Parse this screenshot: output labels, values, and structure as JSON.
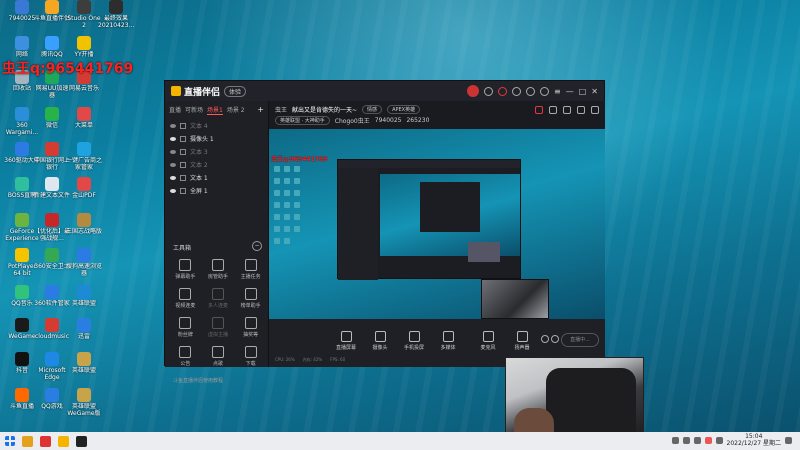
{
  "overlay": {
    "qq_text": "虫王q:965441769"
  },
  "desktop": {
    "icons": [
      {
        "label": "7940025",
        "color": "#3a78d6"
      },
      {
        "label": "斗鱼直播伴侣",
        "color": "#f5a623"
      },
      {
        "label": "Studio One 2",
        "color": "#3d3d3d"
      },
      {
        "label": "最终效果 20210423...",
        "color": "#2d2d2d"
      },
      {
        "label": "网络",
        "color": "#3d8fe0"
      },
      {
        "label": "腾讯QQ",
        "color": "#3aa0ff"
      },
      {
        "label": "YY开播",
        "color": "#f2c200"
      },
      {
        "label": "回收站",
        "color": "#a6b4bf"
      },
      {
        "label": "网易UU加速器",
        "color": "#1ea85b"
      },
      {
        "label": "网易云音乐",
        "color": "#d43c33"
      },
      {
        "label": "360 Wargami...",
        "color": "#2a8fd8"
      },
      {
        "label": "微信",
        "color": "#27b34a"
      },
      {
        "label": "大菜单",
        "color": "#e34848"
      },
      {
        "label": "360驱动大师",
        "color": "#2c7be5"
      },
      {
        "label": "中国银行网上银行",
        "color": "#d43c33"
      },
      {
        "label": "一键广告商之家管家",
        "color": "#1fa2e0"
      },
      {
        "label": "BOSS直聘",
        "color": "#2fbf9f"
      },
      {
        "label": "新建文本文件",
        "color": "#dfe6ee"
      },
      {
        "label": "金山PDF",
        "color": "#e34848"
      },
      {
        "label": "GeForce Experience",
        "color": "#6cb33f"
      },
      {
        "label": "【优化后】最强战舰...",
        "color": "#c62828"
      },
      {
        "label": "三国志战略版",
        "color": "#b38a3f"
      },
      {
        "label": "PotPlayer 64 bit",
        "color": "#f5c400"
      },
      {
        "label": "360安全卫士",
        "color": "#34a853"
      },
      {
        "label": "搜狗高速浏览器",
        "color": "#2c7be5"
      },
      {
        "label": "QQ音乐",
        "color": "#31c27c"
      },
      {
        "label": "360软件管家",
        "color": "#2c7be5"
      },
      {
        "label": "英雄联盟",
        "color": "#1e8ad6"
      },
      {
        "label": "WeGame",
        "color": "#1a1a1a"
      },
      {
        "label": "cloudmusic",
        "color": "#d43c33"
      },
      {
        "label": "迅雷",
        "color": "#2a7de1"
      },
      {
        "label": "抖音",
        "color": "#111111"
      },
      {
        "label": "Microsoft Edge",
        "color": "#1e88e5"
      },
      {
        "label": "英雄联盟",
        "color": "#c7a44a"
      },
      {
        "label": "斗鱼直播",
        "color": "#ff6a00"
      },
      {
        "label": "QQ游戏",
        "color": "#2a7de1"
      },
      {
        "label": "英雄联盟WeGame版",
        "color": "#c7a44a"
      }
    ]
  },
  "app": {
    "logo_text": "直播伴侣",
    "logo_badge": "体验",
    "scene_tabs": [
      "直播",
      "可新场",
      "场景1",
      "场景 2"
    ],
    "sources": [
      {
        "label": "文本 4",
        "on": false
      },
      {
        "label": "摄像头 1",
        "on": true
      },
      {
        "label": "文本 3",
        "on": false
      },
      {
        "label": "文本 2",
        "on": false
      },
      {
        "label": "文本 1",
        "on": true
      },
      {
        "label": "全屏 1",
        "on": true
      }
    ],
    "toolbox_title": "工具箱",
    "tools": [
      {
        "label": "弹幕助手",
        "dim": false
      },
      {
        "label": "房管助手",
        "dim": false
      },
      {
        "label": "主播任务",
        "dim": false
      },
      {
        "label": "视频连麦",
        "dim": false
      },
      {
        "label": "多人连麦",
        "dim": true
      },
      {
        "label": "榜单助手",
        "dim": false
      },
      {
        "label": "粉丝牌",
        "dim": false
      },
      {
        "label": "虚拟主播",
        "dim": true
      },
      {
        "label": "抽奖等",
        "dim": false
      },
      {
        "label": "公告",
        "dim": false
      },
      {
        "label": "点歌",
        "dim": false
      },
      {
        "label": "下载",
        "dim": false
      }
    ],
    "bottom_tip": "斗鱼直播伴侣使用教程",
    "info": {
      "streamer": "虫王",
      "room_title": "献出又是肯德失的一天~",
      "tag1": "情感",
      "tag2": "APEX英雄",
      "row2_a": "英雄联盟 · 大神助手",
      "row2_b": "Chogo0虫王",
      "room_id": "7940025",
      "hot": "265230"
    },
    "controls": [
      "直播屏幕",
      "摄像头",
      "手机投屏",
      "多媒体",
      "麦克风",
      "扬声器"
    ],
    "start_label": "直播中...",
    "status": [
      "CPU: 26%",
      "内存: 42%",
      "FPS: 60"
    ]
  },
  "taskbar": {
    "apps": [
      {
        "name": "start",
        "color": "#1a73e8"
      },
      {
        "name": "files",
        "color": "#e4a11b"
      },
      {
        "name": "stream",
        "color": "#d33"
      },
      {
        "name": "live",
        "color": "#f5b400"
      },
      {
        "name": "obs",
        "color": "#222"
      }
    ],
    "time": "15:04",
    "date": "2022/12/27 星期二"
  }
}
